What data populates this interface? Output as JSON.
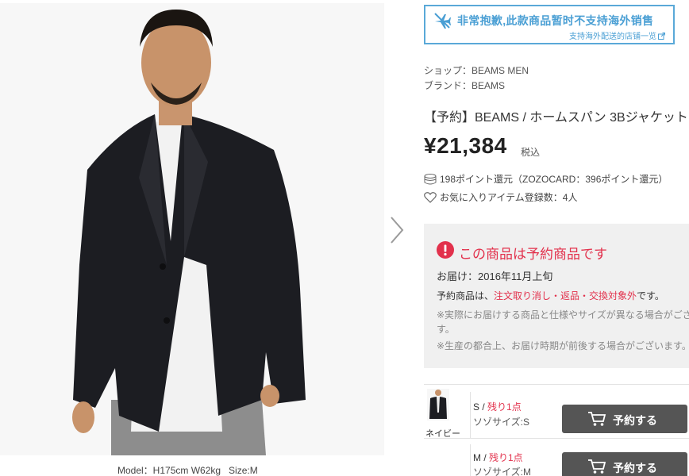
{
  "notice": {
    "title": "非常抱歉,此款商品暂时不支持海外销售",
    "link": "支持海外配送的店铺一览"
  },
  "shop": "ショップ：BEAMS MEN",
  "brand": "ブランド：BEAMS",
  "product_title": "【予約】BEAMS / ホームスパン 3Bジャケット",
  "price": "¥21,384",
  "tax_label": "税込",
  "points": "198ポイント還元（ZOZOCARD：396ポイント還元）",
  "favorites": "お気に入りアイテム登録数：4人",
  "preorder": {
    "title": "この商品は予約商品です",
    "delivery": "お届け：2016年11月上旬",
    "note_prefix": "予約商品は、",
    "note_red": "注文取り消し・返品・交換対象外",
    "note_suffix": "です。",
    "caution1": "※実際にお届けする商品と仕様やサイズが異なる場合がございま",
    "caution1b": "す。",
    "caution2": "※生産の都合上、お届け時期が前後する場合がございます。"
  },
  "model_caption": "Model：H175cm W62kg   Size:M",
  "skus": [
    {
      "color": "ネイビー",
      "size": "S / ",
      "stock": "残り1点",
      "size_jp": "ソゾサイズ:S",
      "button": "予約する"
    },
    {
      "color": "",
      "size": "M / ",
      "stock": "残り1点",
      "size_jp": "ソゾサイズ:M",
      "button": "予約する"
    }
  ],
  "colors": {
    "notice_blue": "#4a9fd4",
    "alert_red": "#e2314c",
    "button_gray": "#555555",
    "jacket_navy": "#1c1d22"
  }
}
